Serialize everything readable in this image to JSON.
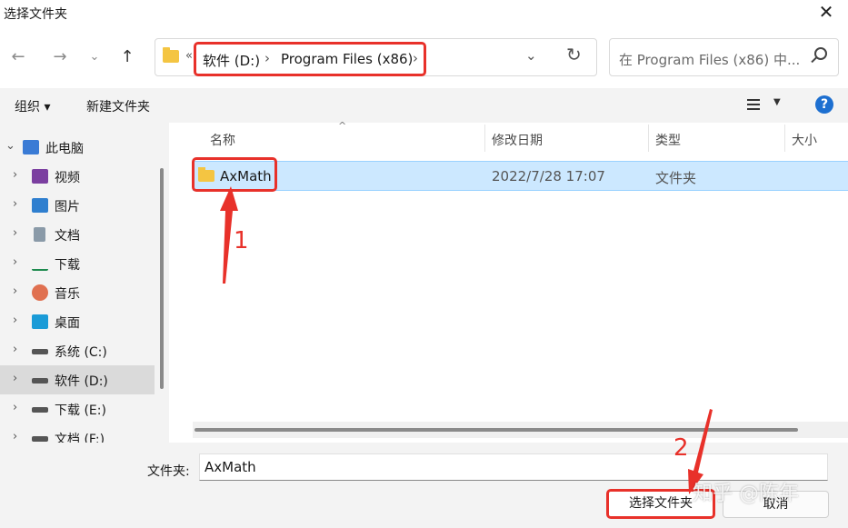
{
  "window": {
    "title": "选择文件夹",
    "close_glyph": "✕"
  },
  "nav": {
    "back": "←",
    "forward": "→",
    "recent": "⌄",
    "up": "↑"
  },
  "address": {
    "overflow": "«",
    "crumbs": [
      "软件 (D:)",
      "Program Files (x86)"
    ],
    "separator": "›",
    "dropdown": "⌄",
    "refresh": "↻"
  },
  "search": {
    "placeholder": "在 Program Files (x86) 中..."
  },
  "toolbar": {
    "organize": "组织 ▾",
    "new_folder": "新建文件夹",
    "help": "?"
  },
  "sidebar": {
    "items": [
      {
        "label": "此电脑",
        "icon": "computer-icon",
        "color": "#3a7bd5",
        "caret": "⌄"
      },
      {
        "label": "视频",
        "icon": "video-icon",
        "color": "#7b3fa0",
        "caret": "›"
      },
      {
        "label": "图片",
        "icon": "picture-icon",
        "color": "#2f7fcf",
        "caret": "›"
      },
      {
        "label": "文档",
        "icon": "document-icon",
        "color": "#8a9aa8",
        "caret": "›"
      },
      {
        "label": "下载",
        "icon": "download-icon",
        "color": "#1d8a4e",
        "caret": "›"
      },
      {
        "label": "音乐",
        "icon": "music-icon",
        "color": "#e07050",
        "caret": "›"
      },
      {
        "label": "桌面",
        "icon": "desktop-icon",
        "color": "#1a9bd7",
        "caret": "›"
      },
      {
        "label": "系统 (C:)",
        "icon": "drive-icon",
        "color": "#555555",
        "caret": "›"
      },
      {
        "label": "软件 (D:)",
        "icon": "drive-icon",
        "color": "#555555",
        "caret": "›"
      },
      {
        "label": "下载 (E:)",
        "icon": "drive-icon",
        "color": "#555555",
        "caret": "›"
      },
      {
        "label": "文档 (F:)",
        "icon": "drive-icon",
        "color": "#555555",
        "caret": "›"
      }
    ]
  },
  "columns": {
    "name": "名称",
    "modified": "修改日期",
    "type": "类型",
    "size": "大小",
    "sort_glyph": "^"
  },
  "rows": [
    {
      "name": "AxMath",
      "modified": "2022/7/28 17:07",
      "type": "文件夹"
    }
  ],
  "bottom": {
    "folder_label": "文件夹:",
    "folder_value": "AxMath",
    "select_button": "选择文件夹",
    "cancel_button": "取消"
  },
  "annotations": {
    "step1": "1",
    "step2": "2",
    "color": "#e8312a"
  },
  "watermark": "知乎 @陈年"
}
